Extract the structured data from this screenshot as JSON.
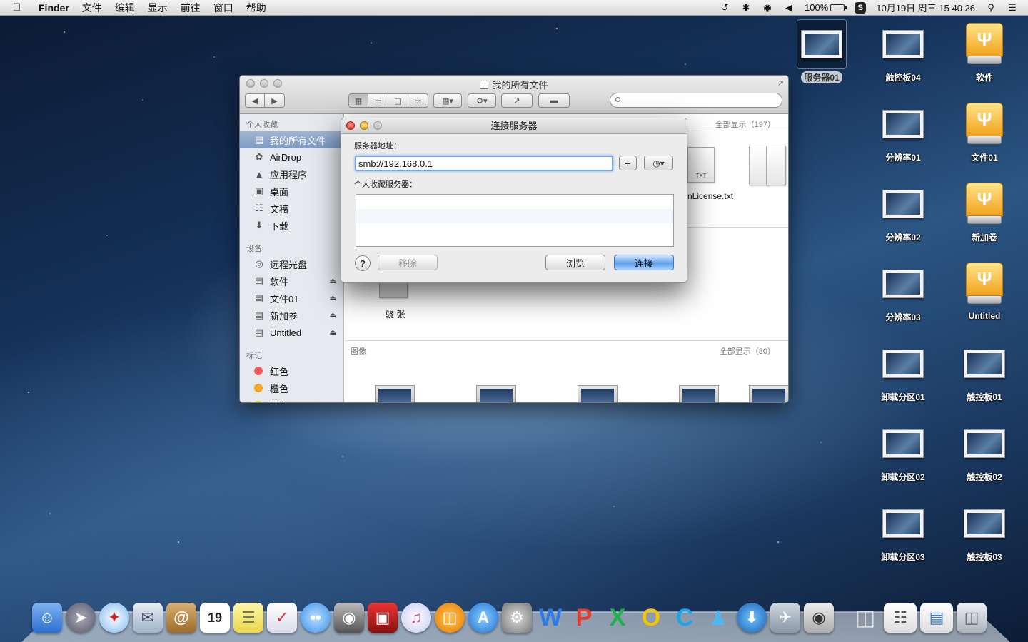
{
  "menubar": {
    "app": "Finder",
    "menus": [
      "文件",
      "编辑",
      "显示",
      "前往",
      "窗口",
      "帮助"
    ],
    "battery": "100%",
    "clock": "10月19日 周三  15 40 26"
  },
  "finder": {
    "title": "我的所有文件",
    "sidebar": {
      "favorites_header": "个人收藏",
      "favorites": [
        "我的所有文件",
        "AirDrop",
        "应用程序",
        "桌面",
        "文稿",
        "下载"
      ],
      "devices_header": "设备",
      "devices": [
        "远程光盘",
        "软件",
        "文件01",
        "新加卷",
        "Untitled"
      ],
      "tags_header": "标记",
      "tags": [
        {
          "label": "红色",
          "color": "#f05a5a"
        },
        {
          "label": "橙色",
          "color": "#f5a623"
        },
        {
          "label": "黄色",
          "color": "#f2d40c"
        }
      ]
    },
    "content": {
      "docs_showall": "全部显示（197）",
      "file_license": "nLicense.txt",
      "txt_tag": "TXT",
      "folder_label": "骁 张",
      "images_header": "图像",
      "images_showall": "全部显示（80）"
    }
  },
  "dialog": {
    "title": "连接服务器",
    "address_label": "服务器地址：",
    "address_value": "smb://192.168.0.1",
    "favorites_label": "个人收藏服务器：",
    "add_label": "+",
    "help_label": "?",
    "remove_label": "移除",
    "browse_label": "浏览",
    "connect_label": "连接"
  },
  "desktop": {
    "icons_col1": [
      "触控板04",
      "分辨率01",
      "分辨率02",
      "分辨率03",
      "卸载分区01",
      "卸载分区02",
      "卸载分区03"
    ],
    "icons_col2": [
      "软件",
      "文件01",
      "新加卷",
      "Untitled",
      "触控板01",
      "触控板02",
      "触控板03"
    ],
    "selected_icon": "服务器01"
  }
}
